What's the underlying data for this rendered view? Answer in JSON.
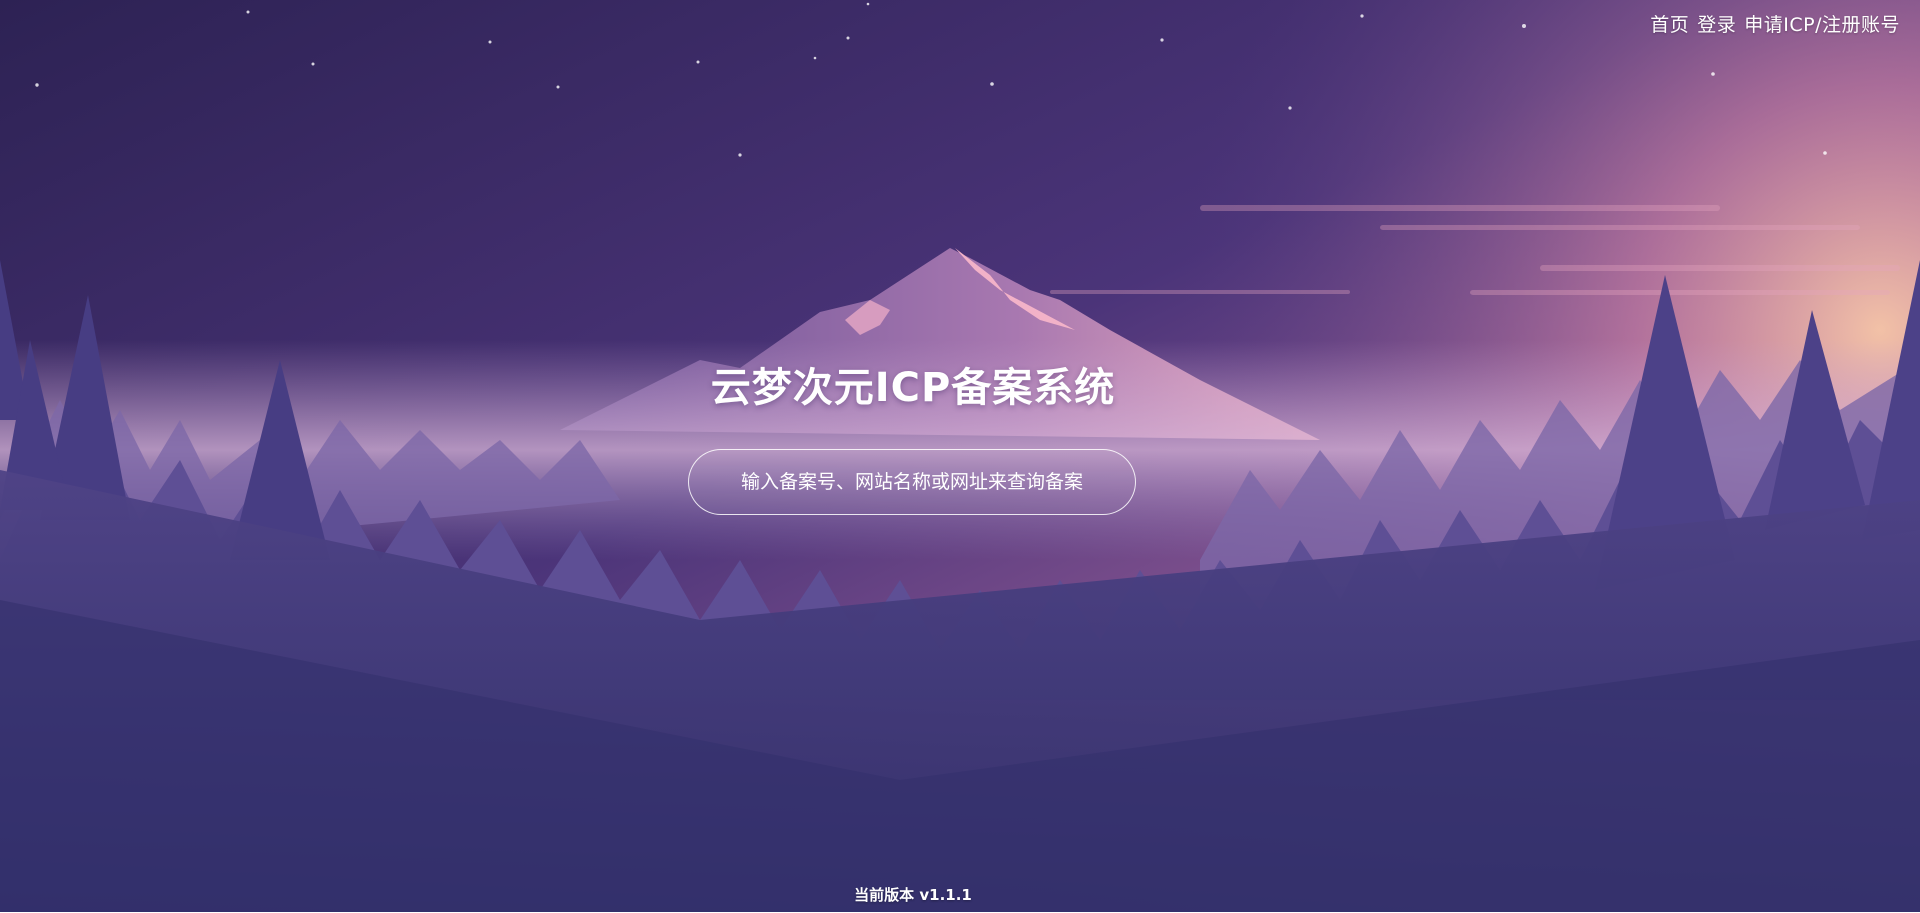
{
  "nav": {
    "items": [
      {
        "label": "首页"
      },
      {
        "label": "登录"
      },
      {
        "label": "申请ICP/注册账号"
      }
    ]
  },
  "hero": {
    "title": "云梦次元ICP备案系统"
  },
  "search": {
    "placeholder": "输入备案号、网站名称或网址来查询备案",
    "value": ""
  },
  "footer": {
    "version_text": "当前版本 v1.1.1"
  },
  "colors": {
    "sky_top": "#2e2356",
    "horizon_glow": "#f3b0b8",
    "mountain": "#5a4a8e",
    "trees_dark": "#4a3f86",
    "ground": "#3a3572"
  }
}
